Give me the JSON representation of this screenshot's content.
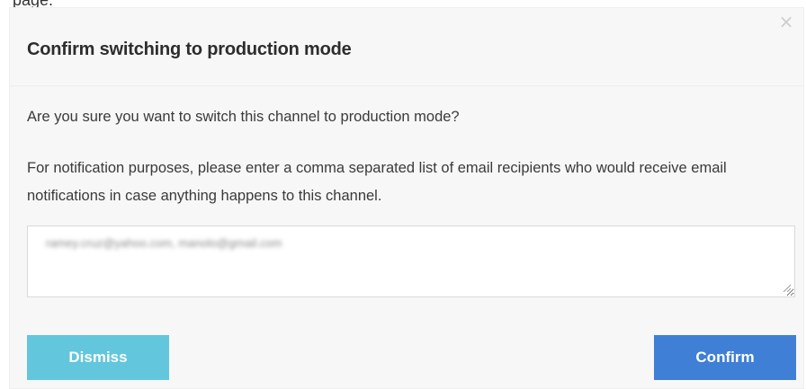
{
  "background": {
    "partial_text": "page."
  },
  "modal": {
    "close_glyph": "×",
    "title": "Confirm switching to production mode",
    "question": "Are you sure you want to switch this channel to production mode?",
    "notice": "For notification purposes, please enter a comma separated list of email recipients who would receive email notifications in case anything happens to this channel.",
    "recipients_value": "ramey.cruz@yahoo.com, manolo@gmail.com",
    "dismiss_label": "Dismiss",
    "confirm_label": "Confirm",
    "colors": {
      "dismiss": "#62c6dc",
      "confirm": "#3f7fd6"
    }
  }
}
